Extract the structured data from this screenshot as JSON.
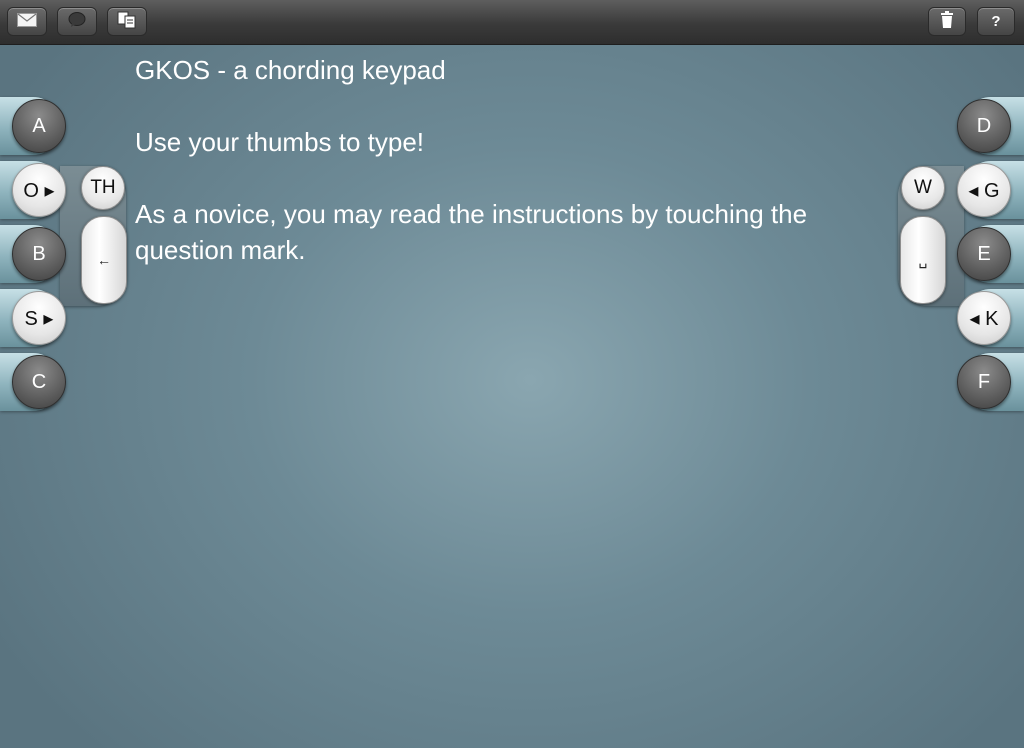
{
  "toolbar": {
    "left_buttons": [
      {
        "name": "mail",
        "icon": "envelope-icon"
      },
      {
        "name": "message",
        "icon": "speech-bubble-icon"
      },
      {
        "name": "copy",
        "icon": "copy-documents-icon"
      }
    ],
    "right_buttons": [
      {
        "name": "trash",
        "icon": "trash-icon"
      },
      {
        "name": "help",
        "icon": "question-mark-icon",
        "label": "?"
      }
    ]
  },
  "content": {
    "title": "GKOS - a chording keypad",
    "line2": "Use your thumbs to type!",
    "line3": "As a novice, you may read the instructions by touching the question mark."
  },
  "left_keypad": {
    "keys": [
      "A",
      "O ▸",
      "B",
      "S ▸",
      "C"
    ],
    "th_label": "TH",
    "backspace_label": "←"
  },
  "right_keypad": {
    "keys": [
      "D",
      "◂ G",
      "E",
      "◂ K",
      "F"
    ],
    "w_label": "W",
    "space_label": "␣"
  }
}
